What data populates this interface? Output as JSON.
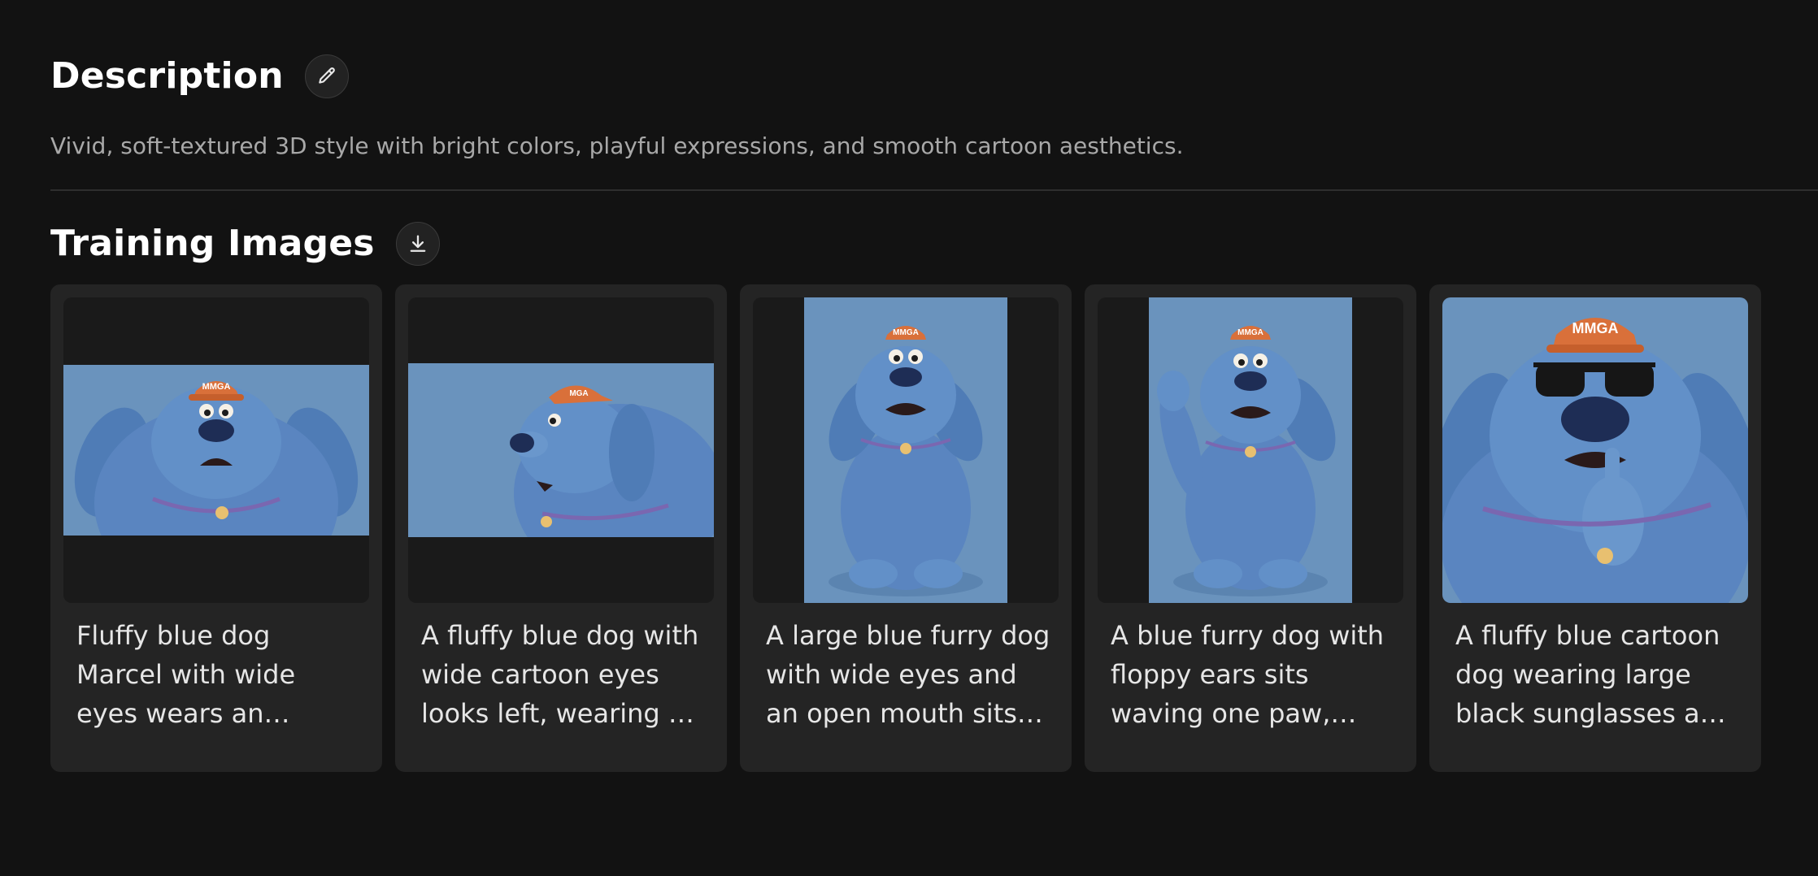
{
  "description": {
    "title": "Description",
    "edit_icon": "pencil-icon",
    "text": "Vivid, soft-textured 3D style with bright colors, playful expressions, and smooth cartoon aesthetics."
  },
  "training": {
    "title": "Training Images",
    "download_icon": "download-icon",
    "images": [
      {
        "caption": "Fluffy blue dog Marcel with wide eyes wears an orange MMGA cap",
        "cap_text": "MMGA"
      },
      {
        "caption": "A fluffy blue dog with wide cartoon eyes looks left, wearing an orange MMGA cap",
        "cap_text": "MGA"
      },
      {
        "caption": "A large blue furry dog with wide eyes and an open mouth sits wearing an orange MMGA cap",
        "cap_text": "MMGA"
      },
      {
        "caption": "A blue furry dog with floppy ears sits waving one paw, wearing an orange MMGA cap",
        "cap_text": "MMGA"
      },
      {
        "caption": "A fluffy blue cartoon dog wearing large black sunglasses and an orange MMGA cap",
        "cap_text": "MMGA"
      }
    ]
  },
  "colors": {
    "background": "#121212",
    "card": "#242424",
    "image_bg": "#6a93bd",
    "dog_fur": "#5a85c0",
    "cap": "#d9703a"
  }
}
